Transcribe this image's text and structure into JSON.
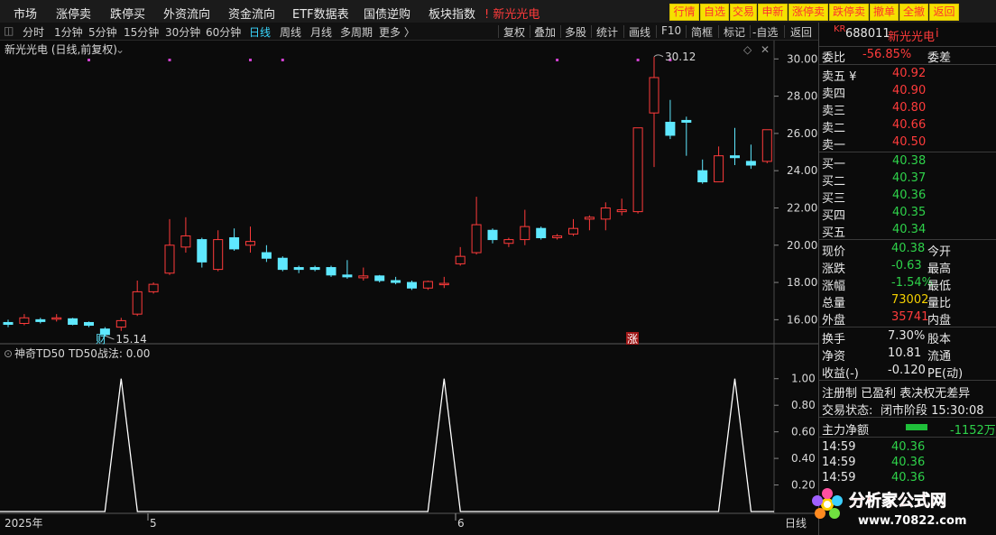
{
  "menu": {
    "items": [
      "市场",
      "涨停卖",
      "跌停买",
      "外资流向",
      "资金流向",
      "ETF数据表",
      "国债逆购",
      "板块指数"
    ],
    "current_stock": "新光光电",
    "quick_buttons": [
      "行情",
      "自选",
      "交易",
      "申新",
      "涨停卖",
      "跌停卖",
      "撤单",
      "全撤",
      "返回"
    ]
  },
  "periods": [
    "分时",
    "1分钟",
    "5分钟",
    "15分钟",
    "30分钟",
    "60分钟",
    "日线",
    "周线",
    "月线",
    "多周期",
    "更多 〉"
  ],
  "active_period": "日线",
  "tools": [
    "复权",
    "叠加",
    "多股",
    "统计",
    "画线",
    "F10",
    "简框",
    "标记",
    "-自选",
    "返回"
  ],
  "chart": {
    "title": "新光光电 (日线,前复权)",
    "max_label": "30.12",
    "min_label": "15.14",
    "event_cai": "财",
    "event_zhang": "涨",
    "y_labels": [
      "30.00",
      "28.00",
      "26.00",
      "24.00",
      "22.00",
      "20.00",
      "18.00",
      "16.00"
    ],
    "indicator_title": "神奇TD50",
    "indicator_value": "TD50战法: 0.00",
    "indicator_y_labels": [
      "1.00",
      "0.80",
      "0.60",
      "0.40",
      "0.20"
    ],
    "x_labels": [
      "2025年",
      "5",
      "6"
    ],
    "period_footer": "日线",
    "up_color": "#ff3b3b",
    "down_color": "#5fe8ff"
  },
  "chart_data": {
    "type": "candlestick",
    "price_range": [
      15.0,
      30.5
    ],
    "candles": [
      {
        "o": 15.85,
        "c": 15.75,
        "h": 16.0,
        "l": 15.6
      },
      {
        "o": 15.8,
        "c": 16.1,
        "h": 16.3,
        "l": 15.7
      },
      {
        "o": 16.0,
        "c": 15.9,
        "h": 16.1,
        "l": 15.8
      },
      {
        "o": 16.1,
        "c": 16.1,
        "h": 16.3,
        "l": 15.9
      },
      {
        "o": 16.05,
        "c": 15.75,
        "h": 16.1,
        "l": 15.7
      },
      {
        "o": 15.85,
        "c": 15.7,
        "h": 15.9,
        "l": 15.6
      },
      {
        "o": 15.5,
        "c": 15.2,
        "h": 15.6,
        "l": 15.14
      },
      {
        "o": 15.6,
        "c": 15.95,
        "h": 16.1,
        "l": 15.4
      },
      {
        "o": 16.3,
        "c": 17.5,
        "h": 18.1,
        "l": 16.2
      },
      {
        "o": 17.5,
        "c": 17.9,
        "h": 18.0,
        "l": 17.4
      },
      {
        "o": 18.5,
        "c": 20.0,
        "h": 21.4,
        "l": 18.4
      },
      {
        "o": 19.9,
        "c": 20.5,
        "h": 21.5,
        "l": 19.6
      },
      {
        "o": 20.3,
        "c": 19.1,
        "h": 20.4,
        "l": 18.8
      },
      {
        "o": 18.7,
        "c": 20.3,
        "h": 20.8,
        "l": 18.6
      },
      {
        "o": 20.4,
        "c": 19.8,
        "h": 20.9,
        "l": 19.7
      },
      {
        "o": 20.0,
        "c": 20.2,
        "h": 21.0,
        "l": 19.6
      },
      {
        "o": 19.6,
        "c": 19.3,
        "h": 20.0,
        "l": 19.1
      },
      {
        "o": 19.3,
        "c": 18.7,
        "h": 19.4,
        "l": 18.6
      },
      {
        "o": 18.8,
        "c": 18.7,
        "h": 18.9,
        "l": 18.5
      },
      {
        "o": 18.8,
        "c": 18.7,
        "h": 18.9,
        "l": 18.6
      },
      {
        "o": 18.8,
        "c": 18.4,
        "h": 18.9,
        "l": 18.3
      },
      {
        "o": 18.4,
        "c": 18.3,
        "h": 19.2,
        "l": 18.2
      },
      {
        "o": 18.25,
        "c": 18.35,
        "h": 18.8,
        "l": 18.1
      },
      {
        "o": 18.35,
        "c": 18.1,
        "h": 18.4,
        "l": 18.0
      },
      {
        "o": 18.1,
        "c": 18.0,
        "h": 18.3,
        "l": 17.9
      },
      {
        "o": 18.0,
        "c": 17.7,
        "h": 18.1,
        "l": 17.6
      },
      {
        "o": 17.7,
        "c": 18.05,
        "h": 18.1,
        "l": 17.6
      },
      {
        "o": 17.9,
        "c": 17.95,
        "h": 18.3,
        "l": 17.7
      },
      {
        "o": 19.0,
        "c": 19.4,
        "h": 19.9,
        "l": 18.9
      },
      {
        "o": 19.6,
        "c": 21.1,
        "h": 22.6,
        "l": 19.5
      },
      {
        "o": 20.8,
        "c": 20.3,
        "h": 20.9,
        "l": 20.1
      },
      {
        "o": 20.1,
        "c": 20.3,
        "h": 20.4,
        "l": 19.9
      },
      {
        "o": 20.3,
        "c": 21.0,
        "h": 21.9,
        "l": 20.0
      },
      {
        "o": 20.9,
        "c": 20.4,
        "h": 21.0,
        "l": 20.3
      },
      {
        "o": 20.4,
        "c": 20.5,
        "h": 20.6,
        "l": 20.3
      },
      {
        "o": 20.6,
        "c": 20.9,
        "h": 21.4,
        "l": 20.5
      },
      {
        "o": 21.4,
        "c": 21.5,
        "h": 21.6,
        "l": 20.8
      },
      {
        "o": 21.4,
        "c": 22.0,
        "h": 22.3,
        "l": 20.8
      },
      {
        "o": 21.8,
        "c": 21.9,
        "h": 22.5,
        "l": 21.6
      },
      {
        "o": 21.8,
        "c": 26.3,
        "h": 26.3,
        "l": 21.7
      },
      {
        "o": 27.1,
        "c": 29.0,
        "h": 30.12,
        "l": 24.2
      },
      {
        "o": 26.6,
        "c": 25.9,
        "h": 27.8,
        "l": 25.7
      },
      {
        "o": 26.7,
        "c": 26.6,
        "h": 26.9,
        "l": 24.8
      },
      {
        "o": 24.0,
        "c": 23.4,
        "h": 24.6,
        "l": 23.3
      },
      {
        "o": 23.4,
        "c": 24.8,
        "h": 25.3,
        "l": 23.4
      },
      {
        "o": 24.8,
        "c": 24.7,
        "h": 26.3,
        "l": 24.3
      },
      {
        "o": 24.5,
        "c": 24.3,
        "h": 25.4,
        "l": 24.1
      },
      {
        "o": 24.5,
        "c": 26.2,
        "h": 26.2,
        "l": 24.4
      }
    ],
    "indicator": {
      "name": "TD50",
      "range": [
        0,
        1.1
      ],
      "spikes_at_candle": [
        7,
        27,
        45
      ],
      "spike_value": 1.0
    }
  },
  "quote": {
    "market_tag": "KR",
    "code": "688011",
    "name": "新光光电",
    "name_suffix": "i",
    "weibi_label": "委比",
    "weibi": "-56.85%",
    "weicha_label": "委差",
    "sell": [
      {
        "label": "卖五 ¥",
        "price": "40.92"
      },
      {
        "label": "卖四",
        "price": "40.90"
      },
      {
        "label": "卖三",
        "price": "40.80"
      },
      {
        "label": "卖二",
        "price": "40.66"
      },
      {
        "label": "卖一",
        "price": "40.50"
      }
    ],
    "buy": [
      {
        "label": "买一",
        "price": "40.38"
      },
      {
        "label": "买二",
        "price": "40.37"
      },
      {
        "label": "买三",
        "price": "40.36"
      },
      {
        "label": "买四",
        "price": "40.35"
      },
      {
        "label": "买五",
        "price": "40.34"
      }
    ],
    "stats": [
      {
        "label": "现价",
        "value": "40.38",
        "label2": "今开",
        "color": "green"
      },
      {
        "label": "涨跌",
        "value": "-0.63",
        "label2": "最高",
        "color": "green"
      },
      {
        "label": "涨幅",
        "value": "-1.54%",
        "label2": "最低",
        "color": "green"
      },
      {
        "label": "总量",
        "value": "73002",
        "label2": "量比",
        "color": "yellow"
      },
      {
        "label": "外盘",
        "value": "35741",
        "label2": "内盘",
        "color": "red"
      }
    ],
    "stats2": [
      {
        "label": "换手",
        "value": "7.30%",
        "label2": "股本"
      },
      {
        "label": "净资",
        "value": "10.81",
        "label2": "流通"
      },
      {
        "label": "收益(-)",
        "value": "-0.120",
        "label2": "PE(动)"
      }
    ],
    "tags": "注册制 已盈利 表决权无差异",
    "trade_status_label": "交易状态:",
    "trade_status": "闭市阶段 15:30:08",
    "main_flow_label": "主力净额",
    "main_flow_value": "-1152万",
    "ticks": [
      {
        "time": "14:59",
        "price": "40.36"
      },
      {
        "time": "14:59",
        "price": "40.36"
      },
      {
        "time": "14:59",
        "price": "40.36"
      }
    ]
  },
  "logo": {
    "text": "分析家公式网",
    "url": "www.70822.com"
  }
}
